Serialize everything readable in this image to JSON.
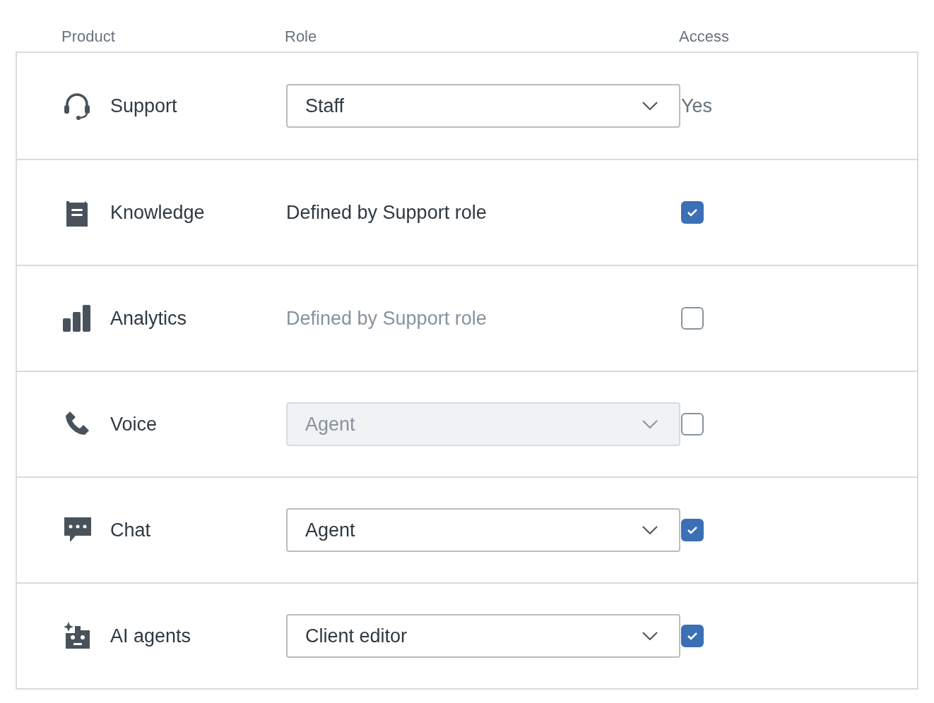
{
  "columns": [
    "Product",
    "Role",
    "Access"
  ],
  "rows": [
    {
      "product": "Support",
      "role": {
        "kind": "select",
        "value": "Staff",
        "disabled": false
      },
      "access": {
        "kind": "text",
        "value": "Yes"
      }
    },
    {
      "product": "Knowledge",
      "role": {
        "kind": "text",
        "value": "Defined by Support role",
        "disabled": false
      },
      "access": {
        "kind": "checkbox",
        "checked": true
      }
    },
    {
      "product": "Analytics",
      "role": {
        "kind": "text",
        "value": "Defined by Support role",
        "disabled": true
      },
      "access": {
        "kind": "checkbox",
        "checked": false
      }
    },
    {
      "product": "Voice",
      "role": {
        "kind": "select",
        "value": "Agent",
        "disabled": true
      },
      "access": {
        "kind": "checkbox",
        "checked": false
      }
    },
    {
      "product": "Chat",
      "role": {
        "kind": "select",
        "value": "Agent",
        "disabled": false
      },
      "access": {
        "kind": "checkbox",
        "checked": true
      }
    },
    {
      "product": "AI agents",
      "role": {
        "kind": "select",
        "value": "Client editor",
        "disabled": false
      },
      "access": {
        "kind": "checkbox",
        "checked": true
      }
    }
  ]
}
